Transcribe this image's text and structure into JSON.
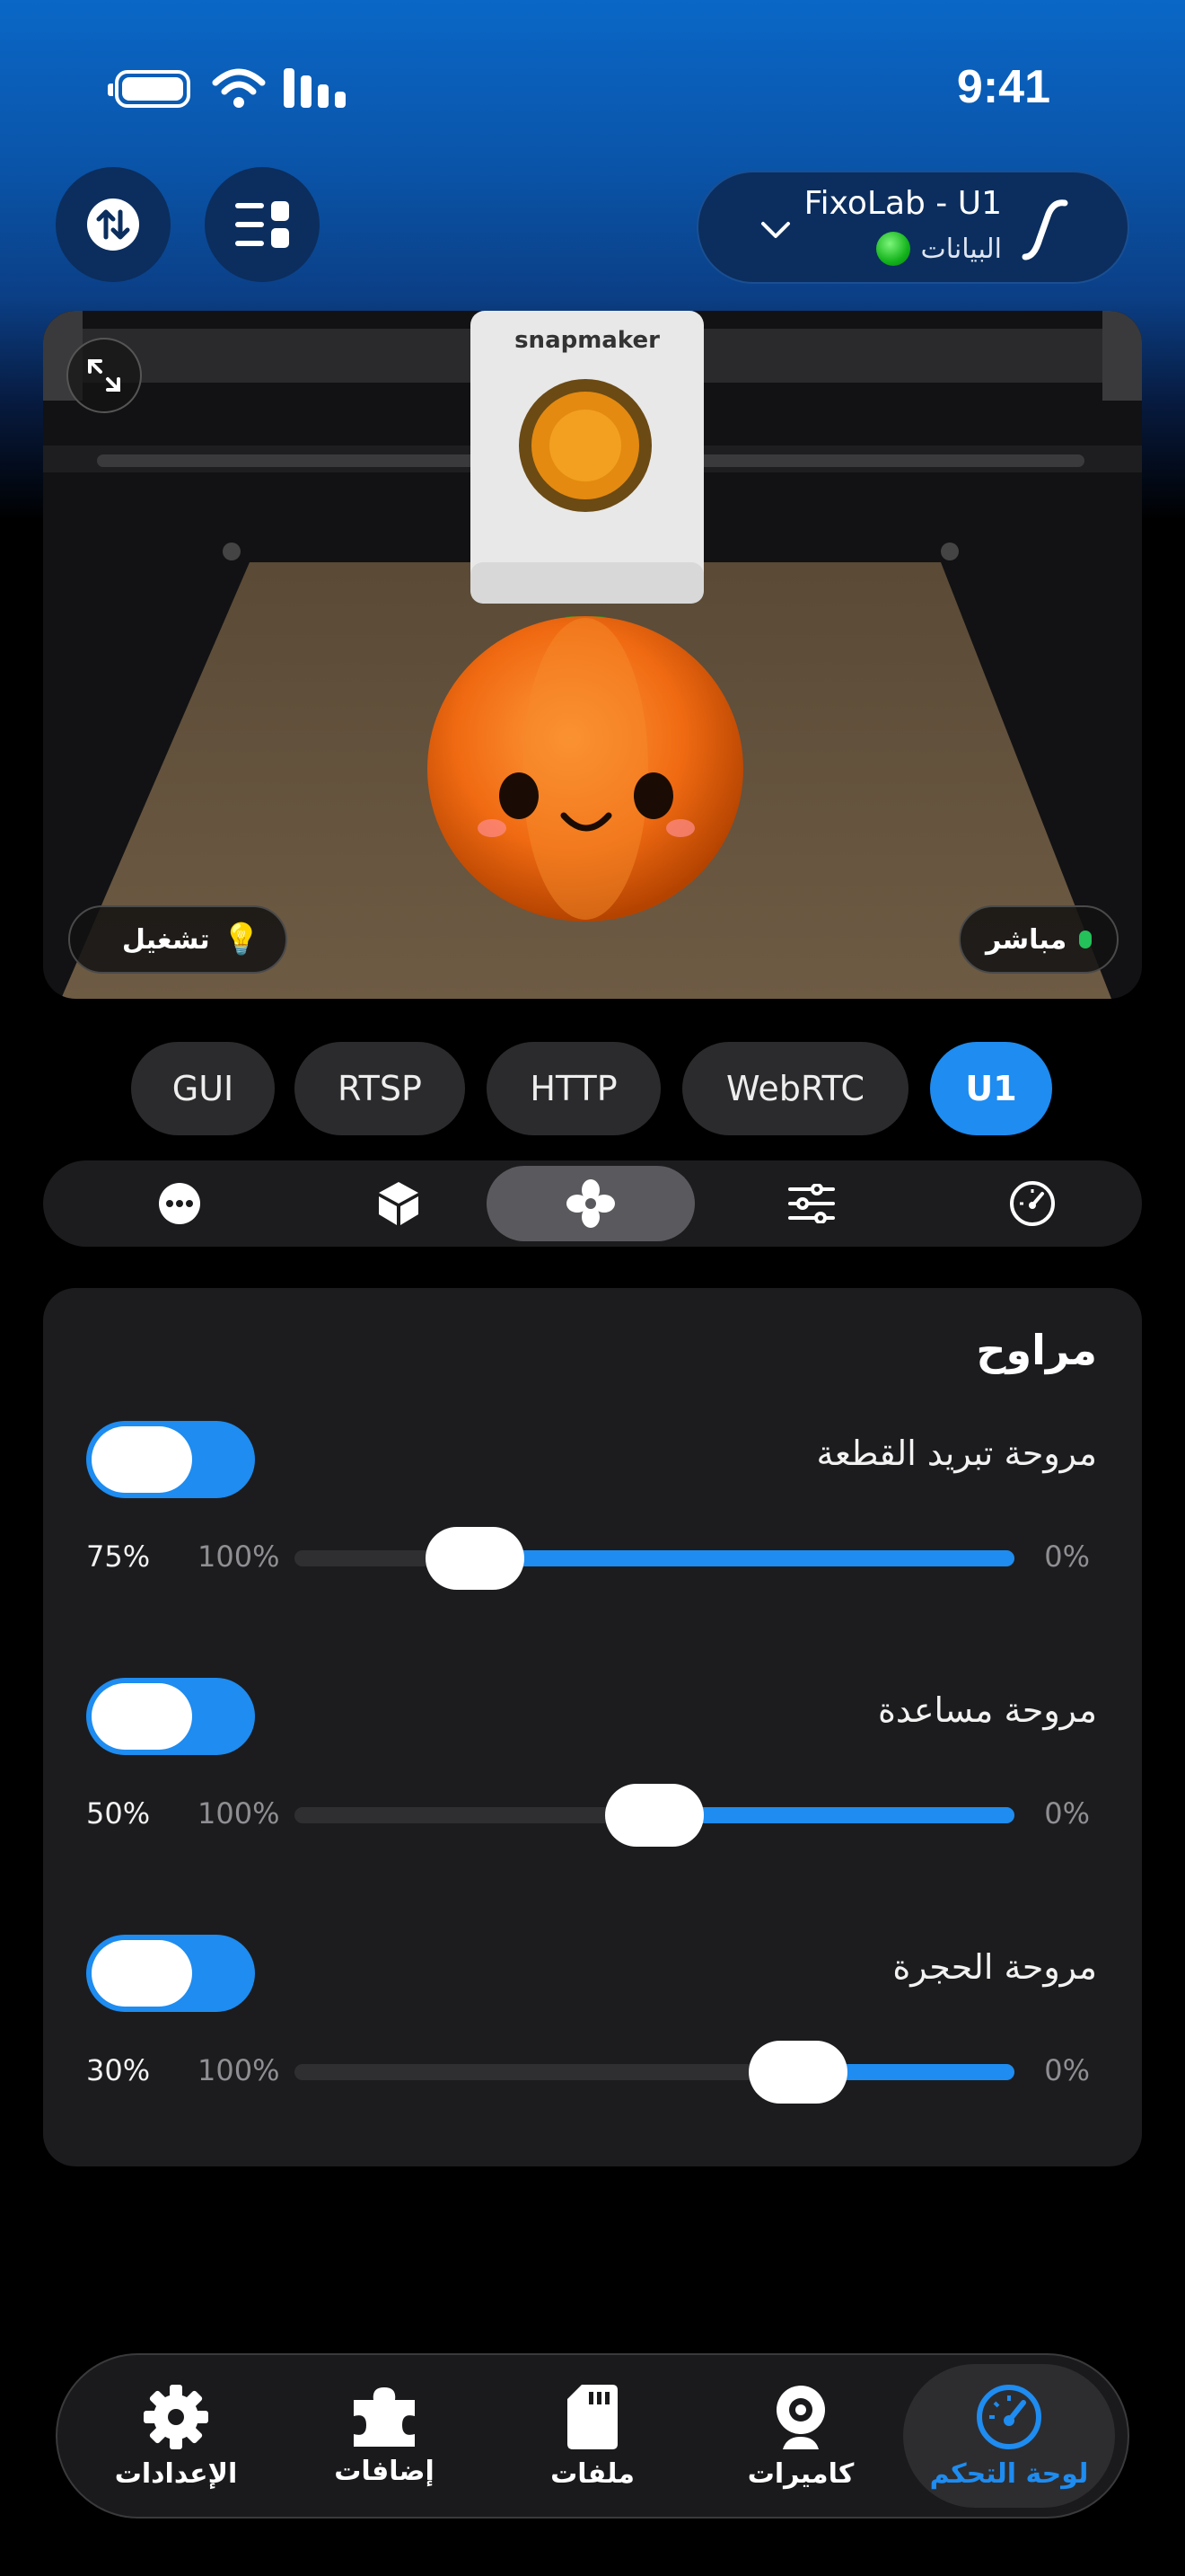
{
  "status_bar": {
    "time": "9:41"
  },
  "header": {
    "printer_name": "FixoLab - U1",
    "printer_status": "البيانات",
    "icons": [
      "swap-vertical-icon",
      "list-grid-icon",
      "chevron-down-icon",
      "curve-icon"
    ]
  },
  "camera": {
    "light_label": "تشغيل",
    "live_label": "مباشر",
    "printer_brand": "snapmaker"
  },
  "stream_tabs": [
    {
      "label": "GUI",
      "active": false
    },
    {
      "label": "RTSP",
      "active": false
    },
    {
      "label": "HTTP",
      "active": false
    },
    {
      "label": "WebRTC",
      "active": false
    },
    {
      "label": "U1",
      "active": true
    }
  ],
  "section_tabs": [
    {
      "icon": "more-icon",
      "active": false
    },
    {
      "icon": "cube-icon",
      "active": false
    },
    {
      "icon": "fan-icon",
      "active": true
    },
    {
      "icon": "sliders-icon",
      "active": false
    },
    {
      "icon": "speedometer-icon",
      "active": false
    }
  ],
  "fans": {
    "title": "مراوح",
    "items": [
      {
        "label": "مروحة تبريد القطعة",
        "enabled": true,
        "value": 75,
        "value_text": "75%",
        "max_text": "100%",
        "min_text": "0%"
      },
      {
        "label": "مروحة مساعدة",
        "enabled": true,
        "value": 50,
        "value_text": "50%",
        "max_text": "100%",
        "min_text": "0%"
      },
      {
        "label": "مروحة الحجرة",
        "enabled": true,
        "value": 30,
        "value_text": "30%",
        "max_text": "100%",
        "min_text": "0%"
      }
    ]
  },
  "bottom_nav": [
    {
      "label": "الإعدادات",
      "icon": "gear-icon",
      "active": false
    },
    {
      "label": "إضافات",
      "icon": "puzzle-icon",
      "active": false
    },
    {
      "label": "ملفات",
      "icon": "sd-card-icon",
      "active": false
    },
    {
      "label": "كاميرات",
      "icon": "webcam-icon",
      "active": false
    },
    {
      "label": "لوحة التحكم",
      "icon": "dashboard-icon",
      "active": true
    }
  ],
  "colors": {
    "accent": "#1e8cf0",
    "card": "#1c1c1e",
    "header_blue": "#0b2e5e"
  }
}
